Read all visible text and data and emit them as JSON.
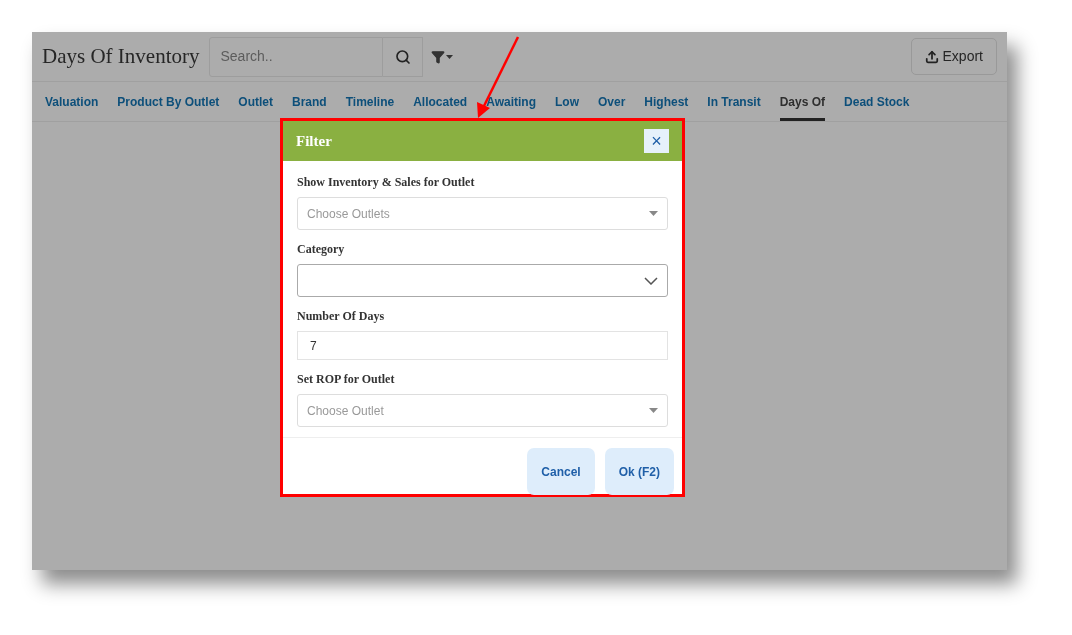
{
  "header": {
    "title": "Days Of Inventory",
    "search": {
      "placeholder": "Search.."
    },
    "export_button": "Export"
  },
  "tabs": [
    {
      "label": "Valuation",
      "selected": false
    },
    {
      "label": "Product By Outlet",
      "selected": false
    },
    {
      "label": "Outlet",
      "selected": false
    },
    {
      "label": "Brand",
      "selected": false
    },
    {
      "label": "Timeline",
      "selected": false
    },
    {
      "label": "Allocated",
      "selected": false
    },
    {
      "label": "Awaiting",
      "selected": false
    },
    {
      "label": "Low",
      "selected": false
    },
    {
      "label": "Over",
      "selected": false
    },
    {
      "label": "Highest",
      "selected": false
    },
    {
      "label": "In Transit",
      "selected": false
    },
    {
      "label": "Days Of",
      "selected": true
    },
    {
      "label": "Dead Stock",
      "selected": false
    }
  ],
  "dialog": {
    "title": "Filter",
    "close": "×",
    "fields": [
      {
        "kind": "select",
        "label": "Show Inventory & Sales for Outlet",
        "placeholder": "Choose Outlets"
      },
      {
        "kind": "dropdown",
        "label": "Category"
      },
      {
        "kind": "number",
        "label": "Number Of Days",
        "value": "7"
      },
      {
        "kind": "select",
        "label": "Set ROP for Outlet",
        "placeholder": "Choose Outlet"
      }
    ],
    "buttons": [
      "Cancel",
      "Ok (F2)"
    ]
  }
}
